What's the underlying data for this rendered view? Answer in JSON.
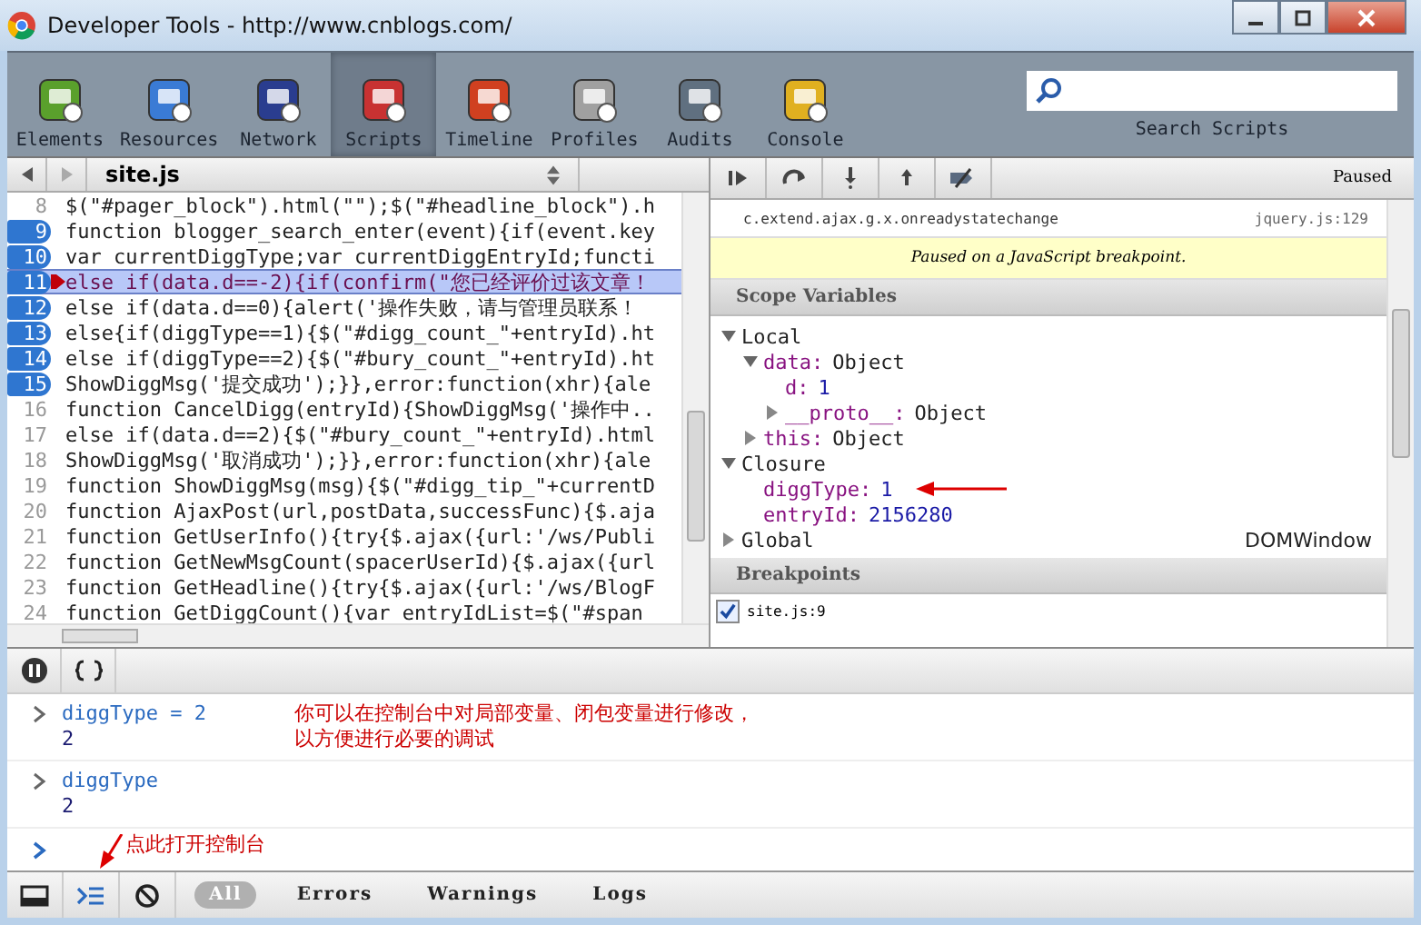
{
  "window": {
    "title": "Developer Tools - http://www.cnblogs.com/"
  },
  "toolbar": {
    "panels": [
      {
        "label": "Elements",
        "selected": false
      },
      {
        "label": "Resources",
        "selected": false
      },
      {
        "label": "Network",
        "selected": false
      },
      {
        "label": "Scripts",
        "selected": true
      },
      {
        "label": "Timeline",
        "selected": false
      },
      {
        "label": "Profiles",
        "selected": false
      },
      {
        "label": "Audits",
        "selected": false
      },
      {
        "label": "Console",
        "selected": false
      }
    ],
    "search_label": "Search Scripts"
  },
  "editor": {
    "file": "site.js",
    "lines": [
      {
        "number": "8",
        "text": "$(\"#pager_block\").html(\"\");$(\"#headline_block\").h",
        "breakpoint": false,
        "current": false
      },
      {
        "number": "9",
        "text": "function blogger_search_enter(event){if(event.key",
        "breakpoint": true,
        "current": false
      },
      {
        "number": "10",
        "text": "var currentDiggType;var currentDiggEntryId;functi",
        "breakpoint": true,
        "current": false
      },
      {
        "number": "11",
        "text": "else if(data.d==-2){if(confirm(\"您已经评价过该文章！",
        "breakpoint": true,
        "current": true
      },
      {
        "number": "12",
        "text": "else if(data.d==0){alert('操作失败，请与管理员联系！",
        "breakpoint": true,
        "current": false
      },
      {
        "number": "13",
        "text": "else{if(diggType==1){$(\"#digg_count_\"+entryId).ht",
        "breakpoint": true,
        "current": false
      },
      {
        "number": "14",
        "text": "else if(diggType==2){$(\"#bury_count_\"+entryId).ht",
        "breakpoint": true,
        "current": false
      },
      {
        "number": "15",
        "text": "ShowDiggMsg('提交成功');}},error:function(xhr){ale",
        "breakpoint": true,
        "current": false
      },
      {
        "number": "16",
        "text": "function CancelDigg(entryId){ShowDiggMsg('操作中..",
        "breakpoint": false,
        "current": false
      },
      {
        "number": "17",
        "text": "else if(data.d==2){$(\"#bury_count_\"+entryId).html",
        "breakpoint": false,
        "current": false
      },
      {
        "number": "18",
        "text": "ShowDiggMsg('取消成功');}},error:function(xhr){ale",
        "breakpoint": false,
        "current": false
      },
      {
        "number": "19",
        "text": "function ShowDiggMsg(msg){$(\"#digg_tip_\"+currentD",
        "breakpoint": false,
        "current": false
      },
      {
        "number": "20",
        "text": "function AjaxPost(url,postData,successFunc){$.aja",
        "breakpoint": false,
        "current": false
      },
      {
        "number": "21",
        "text": "function GetUserInfo(){try{$.ajax({url:'/ws/Publi",
        "breakpoint": false,
        "current": false
      },
      {
        "number": "22",
        "text": "function GetNewMsgCount(spacerUserId){$.ajax({url",
        "breakpoint": false,
        "current": false
      },
      {
        "number": "23",
        "text": "function GetHeadline(){try{$.ajax({url:'/ws/BlogF",
        "breakpoint": false,
        "current": false
      },
      {
        "number": "24",
        "text": "function GetDiggCount(){var entryIdList=$(\"#span",
        "breakpoint": false,
        "current": false
      }
    ]
  },
  "debugger": {
    "status": "Paused",
    "call_stack": {
      "function": "c.extend.ajax.g.x.onreadystatechange",
      "location": "jquery.js:129"
    },
    "message": "Paused on a JavaScript breakpoint.",
    "scope_title": "Scope Variables",
    "scope": [
      {
        "kind": "scope",
        "name": "Local",
        "expanded": true,
        "children": [
          {
            "kind": "object",
            "name": "data:",
            "value": "Object",
            "expanded": true,
            "children": [
              {
                "kind": "number",
                "name": "d:",
                "value": "1"
              },
              {
                "kind": "object",
                "name": "__proto__:",
                "value": "Object",
                "expanded": false
              }
            ]
          },
          {
            "kind": "object",
            "name": "this:",
            "value": "Object",
            "expanded": false
          }
        ]
      },
      {
        "kind": "scope",
        "name": "Closure",
        "expanded": true,
        "children": [
          {
            "kind": "number",
            "name": "diggType:",
            "value": "1",
            "annotated": true
          },
          {
            "kind": "number",
            "name": "entryId:",
            "value": "2156280"
          }
        ]
      },
      {
        "kind": "scope",
        "name": "Global",
        "value": "DOMWindow",
        "expanded": false
      }
    ],
    "breakpoints_title": "Breakpoints",
    "breakpoints": [
      {
        "label": "site.js:9",
        "checked": true
      }
    ]
  },
  "console": {
    "entries": [
      {
        "input": "diggType = 2",
        "output": "2"
      },
      {
        "input": "diggType",
        "output": "2"
      }
    ],
    "note_lines": [
      "你可以在控制台中对局部变量、闭包变量进行修改，",
      "以方便进行必要的调试"
    ],
    "open_note": "点此打开控制台"
  },
  "status_bar": {
    "filters": [
      {
        "label": "All",
        "selected": true
      },
      {
        "label": "Errors",
        "selected": false
      },
      {
        "label": "Warnings",
        "selected": false
      },
      {
        "label": "Logs",
        "selected": false
      }
    ]
  }
}
